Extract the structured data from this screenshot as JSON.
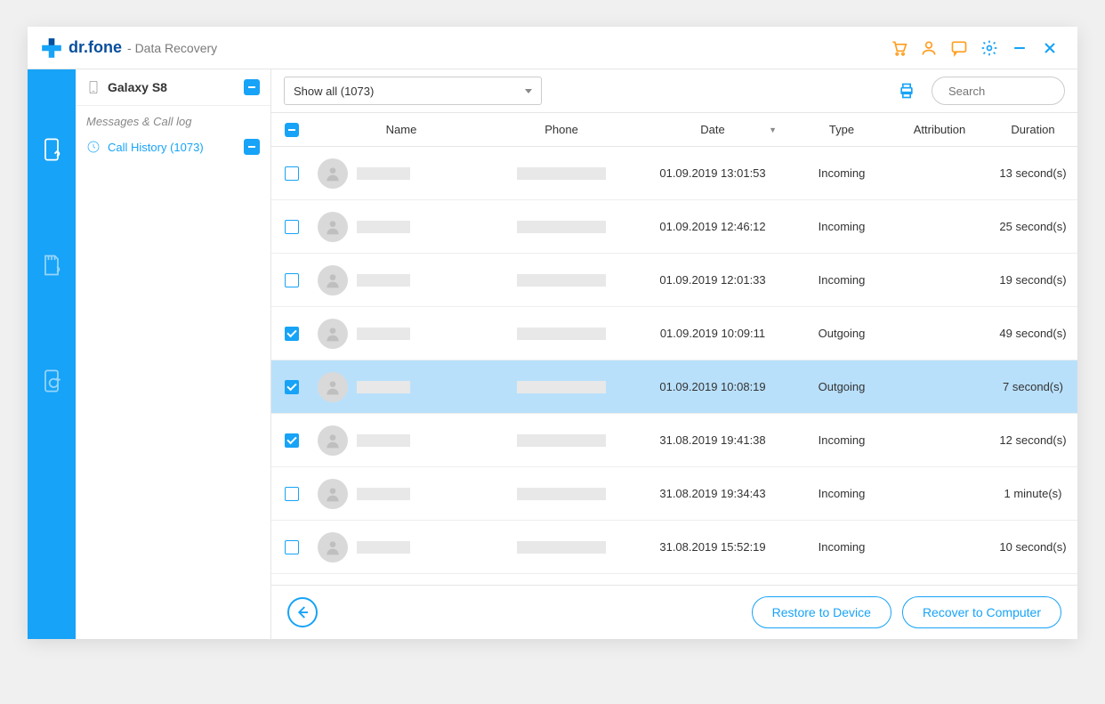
{
  "brand": {
    "name": "dr.fone",
    "subtitle": "- Data Recovery"
  },
  "sidebar": {
    "device": "Galaxy S8",
    "section": "Messages & Call log",
    "item": "Call History (1073)"
  },
  "toolbar": {
    "filter": "Show all (1073)",
    "search_placeholder": "Search"
  },
  "columns": {
    "name": "Name",
    "phone": "Phone",
    "date": "Date",
    "type": "Type",
    "attribution": "Attribution",
    "duration": "Duration"
  },
  "rows": [
    {
      "checked": false,
      "selected": false,
      "date": "01.09.2019 13:01:53",
      "type": "Incoming",
      "attribution": "",
      "duration": "13 second(s)"
    },
    {
      "checked": false,
      "selected": false,
      "date": "01.09.2019 12:46:12",
      "type": "Incoming",
      "attribution": "",
      "duration": "25 second(s)"
    },
    {
      "checked": false,
      "selected": false,
      "date": "01.09.2019 12:01:33",
      "type": "Incoming",
      "attribution": "",
      "duration": "19 second(s)"
    },
    {
      "checked": true,
      "selected": false,
      "date": "01.09.2019 10:09:11",
      "type": "Outgoing",
      "attribution": "",
      "duration": "49 second(s)"
    },
    {
      "checked": true,
      "selected": true,
      "date": "01.09.2019 10:08:19",
      "type": "Outgoing",
      "attribution": "",
      "duration": "7 second(s)"
    },
    {
      "checked": true,
      "selected": false,
      "date": "31.08.2019 19:41:38",
      "type": "Incoming",
      "attribution": "",
      "duration": "12 second(s)"
    },
    {
      "checked": false,
      "selected": false,
      "date": "31.08.2019 19:34:43",
      "type": "Incoming",
      "attribution": "",
      "duration": "1 minute(s)"
    },
    {
      "checked": false,
      "selected": false,
      "date": "31.08.2019 15:52:19",
      "type": "Incoming",
      "attribution": "",
      "duration": "10 second(s)"
    }
  ],
  "footer": {
    "restore": "Restore to Device",
    "recover": "Recover to Computer"
  }
}
